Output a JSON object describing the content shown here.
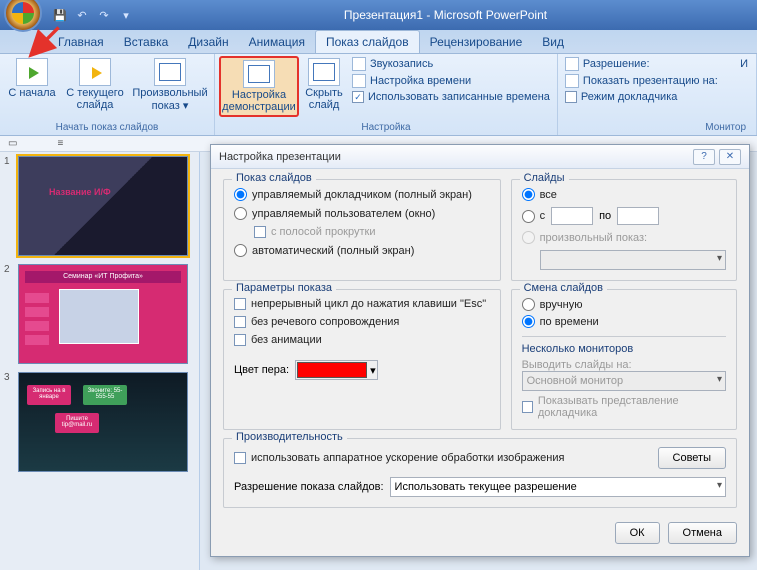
{
  "app": {
    "title": "Презентация1 - Microsoft PowerPoint"
  },
  "qat": [
    "save-icon",
    "undo-icon",
    "redo-icon",
    "repeat-icon"
  ],
  "tabs": {
    "items": [
      "Главная",
      "Вставка",
      "Дизайн",
      "Анимация",
      "Показ слайдов",
      "Рецензирование",
      "Вид"
    ],
    "active_index": 4
  },
  "ribbon": {
    "group1": {
      "title": "Начать показ слайдов",
      "btn1": "С начала",
      "btn2": "С текущего слайда",
      "btn3": "Произвольный показ ▾"
    },
    "group2": {
      "btn1": "Настройка демонстрации",
      "btn2": "Скрыть слайд",
      "row1": "Звукозапись",
      "row2": "Настройка времени",
      "row3": "Использовать записанные времена",
      "title": "Настройка"
    },
    "group3": {
      "row1": "Разрешение:",
      "row2": "Показать презентацию на:",
      "row3": "Режим докладчика",
      "title": "Монитор",
      "extra": "И"
    }
  },
  "thumbs": {
    "t1": {
      "num": "1",
      "title": "Название И/Ф"
    },
    "t2": {
      "num": "2",
      "banner": "Семинар «ИТ Профита»"
    },
    "t3": {
      "num": "3",
      "b1": "Запись на в январе",
      "b2": "Звоните: 55-555-55",
      "b3": "Пишите tip@mail.ru"
    }
  },
  "dialog": {
    "title": "Настройка презентации",
    "help": "?",
    "close": "✕",
    "fs_show": {
      "legend": "Показ слайдов",
      "r1": "управляемый докладчиком (полный экран)",
      "r2": "управляемый пользователем (окно)",
      "chk_scroll": "с полосой прокрутки",
      "r3": "автоматический (полный экран)"
    },
    "fs_slides": {
      "legend": "Слайды",
      "r_all": "все",
      "r_from": "с",
      "to": "по",
      "r_custom": "произвольный показ:"
    },
    "fs_params": {
      "legend": "Параметры показа",
      "c1": "непрерывный цикл до нажатия клавиши \"Esc\"",
      "c2": "без речевого сопровождения",
      "c3": "без анимации",
      "pen": "Цвет пера:"
    },
    "fs_advance": {
      "legend": "Смена слайдов",
      "r1": "вручную",
      "r2": "по времени"
    },
    "fs_monitors": {
      "legend": "Несколько мониторов",
      "lbl": "Выводить слайды на:",
      "val": "Основной монитор",
      "chk": "Показывать представление докладчика"
    },
    "fs_perf": {
      "legend": "Производительность",
      "chk": "использовать аппаратное ускорение обработки изображения",
      "tips": "Советы",
      "res_lbl": "Разрешение показа слайдов:",
      "res_val": "Использовать текущее разрешение"
    },
    "ok": "ОК",
    "cancel": "Отмена"
  }
}
